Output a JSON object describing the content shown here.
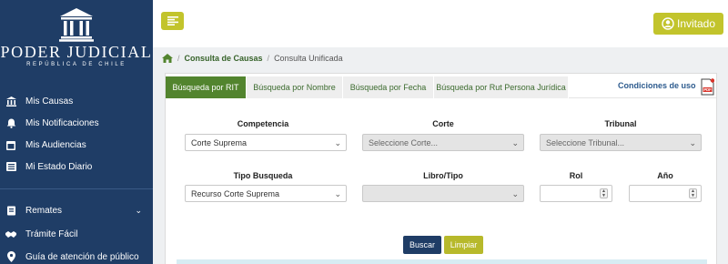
{
  "brand": {
    "title": "PODER JUDICIAL",
    "subtitle": "REPÚBLICA DE CHILE"
  },
  "sidebar": {
    "items": [
      {
        "label": "Mis Causas",
        "icon": "bank-icon"
      },
      {
        "label": "Mis Notificaciones",
        "icon": "bell-icon"
      },
      {
        "label": "Mis Audiencias",
        "icon": "calendar-icon"
      },
      {
        "label": "Mi Estado Diario",
        "icon": "newspaper-icon"
      },
      {
        "label": "Remates",
        "icon": "gavel-icon"
      },
      {
        "label": "Trámite Fácil",
        "icon": "handshake-icon"
      },
      {
        "label": "Guía de atención de público",
        "icon": "map-pin-icon"
      }
    ]
  },
  "header": {
    "user_label": "Invitado"
  },
  "breadcrumb": {
    "section": "Consulta de Causas",
    "current": "Consulta Unificada"
  },
  "tabs": [
    {
      "label": "Búsqueda por RIT",
      "active": true
    },
    {
      "label": "Búsqueda por Nombre",
      "active": false
    },
    {
      "label": "Búsqueda por Fecha",
      "active": false
    },
    {
      "label": "Búsqueda por Rut Persona Jurídica",
      "active": false
    }
  ],
  "conditions_link": "Condiciones de uso",
  "form": {
    "competencia": {
      "label": "Competencia",
      "value": "Corte Suprema"
    },
    "corte": {
      "label": "Corte",
      "value": "Seleccione Corte..."
    },
    "tribunal": {
      "label": "Tribunal",
      "value": "Seleccione Tribunal..."
    },
    "tipo_busqueda": {
      "label": "Tipo Busqueda",
      "value": "Recurso Corte Suprema"
    },
    "libro_tipo": {
      "label": "Libro/Tipo",
      "value": ""
    },
    "rol": {
      "label": "Rol",
      "value": ""
    },
    "anio": {
      "label": "Año",
      "value": ""
    }
  },
  "actions": {
    "search": "Buscar",
    "clear": "Limpiar"
  },
  "colors": {
    "sidebar": "#1f3d66",
    "accent": "#c2c42c",
    "active_tab": "#52842e",
    "link": "#2d5b8e"
  }
}
